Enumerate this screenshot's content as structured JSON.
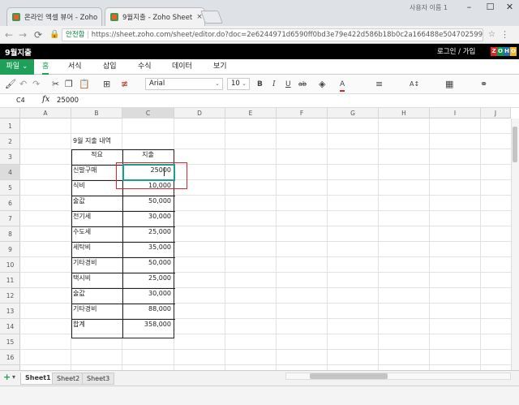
{
  "browser": {
    "tabs": [
      {
        "title": "온라인 엑셀 뷰어 - Zoho",
        "close": "×"
      },
      {
        "title": "9월지출 - Zoho Sheet",
        "close": "×"
      }
    ],
    "user_label": "사용자 이름 1",
    "window_controls": [
      "–",
      "☐",
      "✕"
    ],
    "secure_label": "안전함",
    "url": "https://sheet.zoho.com/sheet/editor.do?doc=2e6244971d6590ff0bd3e79e422d586b18b0c2a166488e504702599..."
  },
  "app": {
    "doc_title": "9월지출",
    "login_link": "로그인 / 가입",
    "brand_letters": [
      "Z",
      "O",
      "H",
      "O"
    ],
    "brand_colors": [
      "#e42527",
      "#089949",
      "#226db4",
      "#f9b21d"
    ],
    "accent_color": "#1ea05a"
  },
  "menu": {
    "file": "파일 ⌄",
    "items": [
      "홈",
      "서식",
      "삽입",
      "수식",
      "데이터",
      "보기"
    ],
    "active": "홈"
  },
  "toolbar": {
    "font_name": "Arial",
    "font_size": "10",
    "bold": "B",
    "italic": "I",
    "underline": "U",
    "strike": "ab",
    "font_color": "A"
  },
  "formula_bar": {
    "cell_ref": "C4",
    "fx": "fx",
    "value": "25000"
  },
  "grid": {
    "columns": [
      "A",
      "B",
      "C",
      "D",
      "E",
      "F",
      "G",
      "H",
      "I",
      "J"
    ],
    "selected_column": "C",
    "rows": [
      "1",
      "2",
      "3",
      "4",
      "5",
      "6",
      "7",
      "8",
      "9",
      "10",
      "11",
      "12",
      "13",
      "14",
      "15",
      "16"
    ],
    "selected_row": "4",
    "sheet_title": "9월 지출 내역",
    "header_item": "적요",
    "header_amount": "지출",
    "entries": [
      {
        "item": "신발구매",
        "amount": "25000"
      },
      {
        "item": "식비",
        "amount": "10,000"
      },
      {
        "item": "술값",
        "amount": "50,000"
      },
      {
        "item": "전기세",
        "amount": "30,000"
      },
      {
        "item": "수도세",
        "amount": "25,000"
      },
      {
        "item": "세탁비",
        "amount": "35,000"
      },
      {
        "item": "기타경비",
        "amount": "50,000"
      },
      {
        "item": "택시비",
        "amount": "25,000"
      },
      {
        "item": "술값",
        "amount": "30,000"
      },
      {
        "item": "기타경비",
        "amount": "88,000"
      },
      {
        "item": "합계",
        "amount": "358,000"
      }
    ]
  },
  "sheets": {
    "add": "+",
    "menu": "▾",
    "tabs": [
      "Sheet1",
      "Sheet2",
      "Sheet3"
    ],
    "active": "Sheet1"
  }
}
